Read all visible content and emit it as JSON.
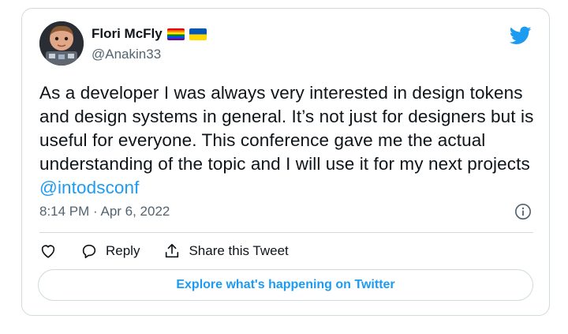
{
  "author": {
    "name": "Flori McFly",
    "handle": "@Anakin33",
    "flags": [
      "rainbow-flag",
      "ukraine-flag"
    ]
  },
  "tweet": {
    "text": "As a developer I was always very interested in design tokens and design systems in general. It’s not just for designers but is useful for everyone. This conference gave me the actual understanding of the topic and I will use it for my next projects ",
    "mention": "@intodsconf",
    "timestamp": "8:14 PM · Apr 6, 2022"
  },
  "actions": {
    "like_icon": "heart-icon",
    "reply_label": "Reply",
    "share_label": "Share this Tweet"
  },
  "cta": {
    "explore_label": "Explore what's happening on Twitter"
  },
  "colors": {
    "accent": "#1d9bf0",
    "text": "#0f1419",
    "secondary": "#536471",
    "border": "#cfd9de"
  }
}
